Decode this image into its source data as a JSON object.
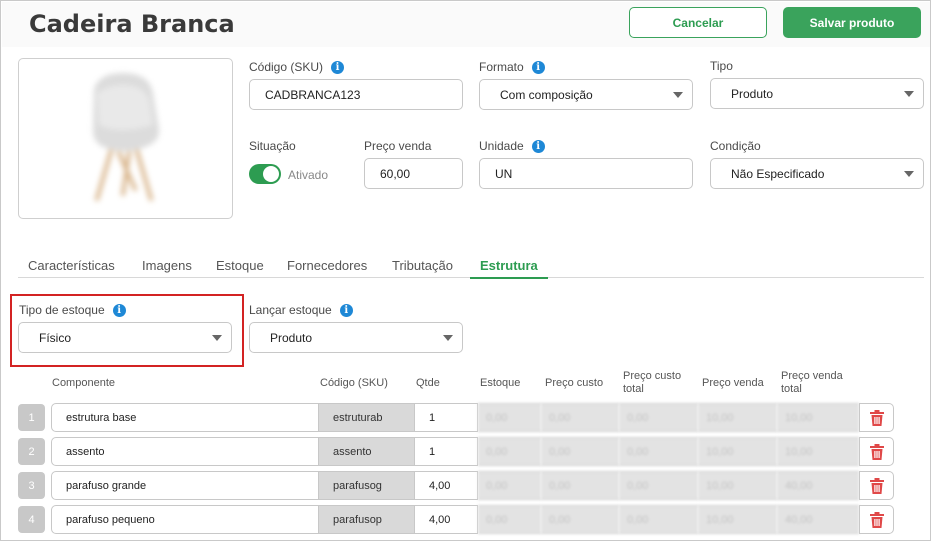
{
  "header": {
    "title": "Cadeira Branca",
    "cancel_label": "Cancelar",
    "save_label": "Salvar produto"
  },
  "form": {
    "sku_label": "Código (SKU)",
    "sku_value": "CADBRANCA123",
    "formato_label": "Formato",
    "formato_value": "Com composição",
    "tipo_label": "Tipo",
    "tipo_value": "Produto",
    "situacao_label": "Situação",
    "situacao_value": "Ativado",
    "preco_label": "Preço venda",
    "preco_value": "60,00",
    "unidade_label": "Unidade",
    "unidade_value": "UN",
    "condicao_label": "Condição",
    "condicao_value": "Não Especificado"
  },
  "tabs": [
    "Características",
    "Imagens",
    "Estoque",
    "Fornecedores",
    "Tributação",
    "Estrutura"
  ],
  "estrutura": {
    "tipo_estoque_label": "Tipo de estoque",
    "tipo_estoque_value": "Físico",
    "lancar_estoque_label": "Lançar estoque",
    "lancar_estoque_value": "Produto"
  },
  "table": {
    "headers": {
      "componente": "Componente",
      "codigo": "Código (SKU)",
      "qtde": "Qtde",
      "estoque": "Estoque",
      "preco_custo": "Preço custo",
      "preco_custo_total": [
        "Preço custo",
        "total"
      ],
      "preco_venda": "Preço venda",
      "preco_venda_total": [
        "Preço venda",
        "total"
      ]
    },
    "rows": [
      {
        "num": "1",
        "componente": "estrutura base",
        "codigo": "estruturab",
        "qtde": "1",
        "estoque": "0,00",
        "preco_custo": "0,00",
        "preco_custo_total": "0,00",
        "preco_venda": "10,00",
        "preco_venda_total": "10,00"
      },
      {
        "num": "2",
        "componente": "assento",
        "codigo": "assento",
        "qtde": "1",
        "estoque": "0,00",
        "preco_custo": "0,00",
        "preco_custo_total": "0,00",
        "preco_venda": "10,00",
        "preco_venda_total": "10,00"
      },
      {
        "num": "3",
        "componente": "parafuso grande",
        "codigo": "parafusog",
        "qtde": "4,00",
        "estoque": "0,00",
        "preco_custo": "0,00",
        "preco_custo_total": "0,00",
        "preco_venda": "10,00",
        "preco_venda_total": "40,00"
      },
      {
        "num": "4",
        "componente": "parafuso pequeno",
        "codigo": "parafusop",
        "qtde": "4,00",
        "estoque": "0,00",
        "preco_custo": "0,00",
        "preco_custo_total": "0,00",
        "preco_venda": "10,00",
        "preco_venda_total": "40,00"
      }
    ]
  },
  "colors": {
    "accent": "#3aa35c",
    "info": "#1e88d6",
    "highlight": "#d32323",
    "delete": "#e04848"
  },
  "icons": {
    "info": "info-icon",
    "dropdown": "chevron-down-icon",
    "delete": "trash-icon",
    "product_image": "chair-image"
  }
}
